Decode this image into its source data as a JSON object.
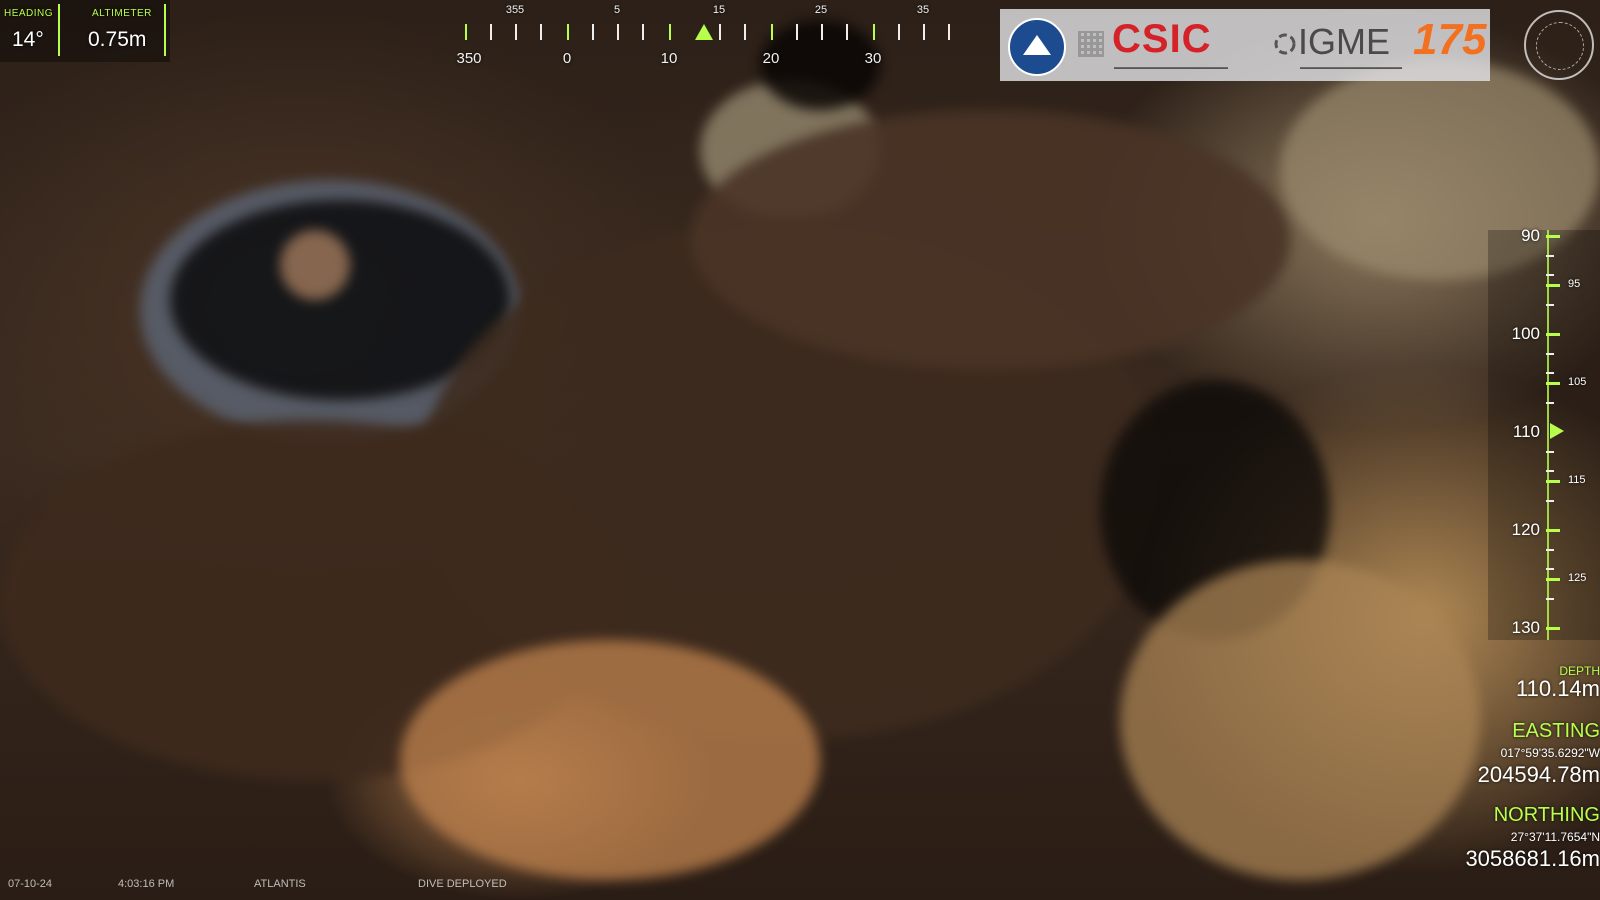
{
  "hud": {
    "heading": {
      "label": "HEADING",
      "value": "14°"
    },
    "altimeter": {
      "label": "ALTIMETER",
      "value": "0.75m"
    }
  },
  "compass": {
    "top_labels": [
      "355",
      "5",
      "15",
      "25",
      "35"
    ],
    "bottom_labels": [
      "350",
      "0",
      "10",
      "20",
      "30"
    ]
  },
  "logos": {
    "csic": "CSIC",
    "igme": "IGME",
    "igme_anniversary": "175"
  },
  "depth_scale": {
    "major": [
      "90",
      "100",
      "110",
      "120",
      "130"
    ],
    "minor": [
      "95",
      "105",
      "115",
      "125"
    ]
  },
  "navigation": {
    "depth_label": "DEPTH",
    "depth_value": "110.14m",
    "easting_label": "EASTING",
    "easting_coord": "017°59'35.6292\"W",
    "easting_value": "204594.78m",
    "northing_label": "NORTHING",
    "northing_coord": "27°37'11.7654\"N",
    "northing_value": "3058681.16m"
  },
  "status_bar": {
    "date": "07-10-24",
    "time": "4:03:16 PM",
    "vehicle": "ATLANTIS",
    "mode": "DIVE DEPLOYED"
  },
  "colors": {
    "hud_accent": "#b7ff4a",
    "csic_red": "#d52128",
    "igme_orange": "#f37021"
  }
}
